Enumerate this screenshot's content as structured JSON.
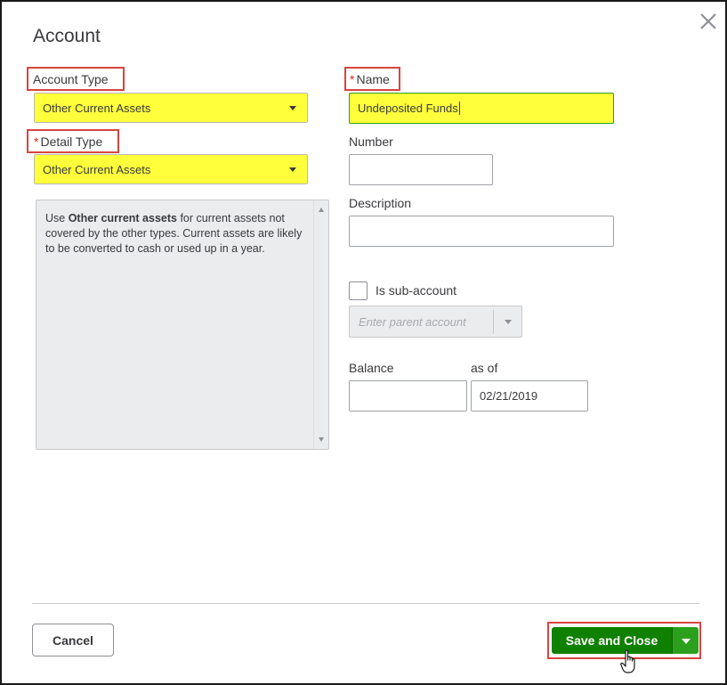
{
  "dialog": {
    "title": "Account",
    "close_icon": "close-icon"
  },
  "account_type": {
    "label": "Account Type",
    "value": "Other Current Assets"
  },
  "detail_type": {
    "required_mark": "*",
    "label": "Detail Type",
    "value": "Other Current Assets"
  },
  "description_panel": {
    "prefix": "Use ",
    "bold": "Other current assets",
    "suffix": " for current assets not covered by the other types. Current assets are likely to be converted to cash or used up in a year."
  },
  "name": {
    "required_mark": "*",
    "label": "Name",
    "value": "Undeposited Funds"
  },
  "number": {
    "label": "Number",
    "value": ""
  },
  "description": {
    "label": "Description",
    "value": ""
  },
  "sub_account": {
    "label": "Is sub-account",
    "checked": false,
    "parent_placeholder": "Enter parent account"
  },
  "balance": {
    "label": "Balance",
    "value": "",
    "as_of_label": "as of",
    "as_of_value": "02/21/2019"
  },
  "footer": {
    "cancel_label": "Cancel",
    "save_label": "Save and Close"
  },
  "colors": {
    "highlight_yellow": "#ffff3b",
    "annotation_red": "#d9453f",
    "primary_green": "#108000",
    "split_green": "#2ca01c",
    "required_red": "#d52b1e"
  }
}
